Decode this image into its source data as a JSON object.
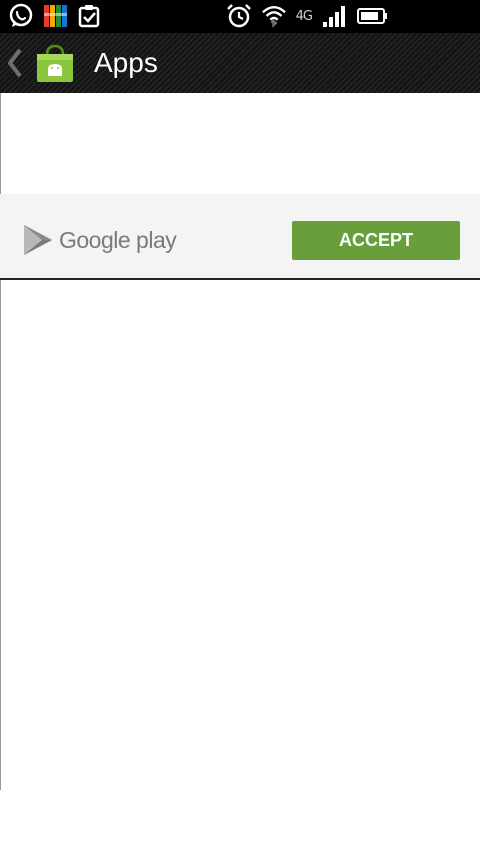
{
  "status_bar": {
    "left_icons": [
      "whatsapp-icon",
      "avg-antivirus-icon",
      "task-clipboard-icon"
    ],
    "right_icons": [
      "alarm-clock-icon",
      "wifi-icon",
      "signal-bars-icon",
      "battery-icon"
    ],
    "network_type": "4G"
  },
  "action_bar": {
    "title": "Apps",
    "back_icon": "chevron-left-icon",
    "app_icon": "shopping-bag-android-icon"
  },
  "banner": {
    "logo_text": "Google play",
    "accept_label": "ACCEPT"
  },
  "colors": {
    "accept_button": "#699f3a",
    "banner_background": "#f4f4f4",
    "status_bar": "#000000"
  }
}
